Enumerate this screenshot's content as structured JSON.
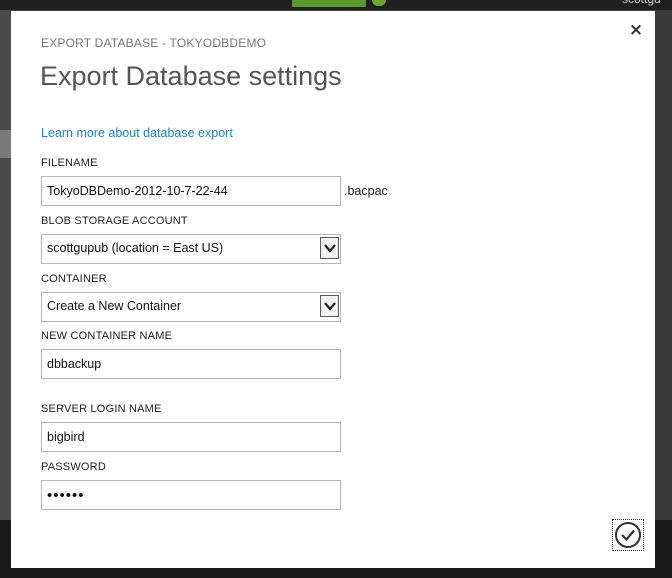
{
  "background": {
    "user_text": "scottgu"
  },
  "dialog": {
    "subtitle": "EXPORT DATABASE - TOKYODBDEMO",
    "title": "Export Database settings",
    "learn_more_link": "Learn more about database export",
    "close_glyph": "×"
  },
  "fields": {
    "filename": {
      "label": "FILENAME",
      "value": "TokyoDBDemo-2012-10-7-22-44",
      "suffix": ".bacpac"
    },
    "blob_storage_account": {
      "label": "BLOB STORAGE ACCOUNT",
      "value": "scottgupub (location = East US)"
    },
    "container": {
      "label": "CONTAINER",
      "value": "Create a New Container"
    },
    "new_container_name": {
      "label": "NEW CONTAINER NAME",
      "value": "dbbackup"
    },
    "server_login_name": {
      "label": "SERVER LOGIN NAME",
      "value": "bigbird"
    },
    "password": {
      "label": "PASSWORD",
      "value": "dbpass"
    }
  },
  "icons": {
    "close": "close-icon",
    "dropdown": "chevron-down-icon",
    "confirm": "checkmark-icon"
  },
  "colors": {
    "link": "#1a82c4",
    "title": "#555555",
    "subtitle": "#777777"
  }
}
